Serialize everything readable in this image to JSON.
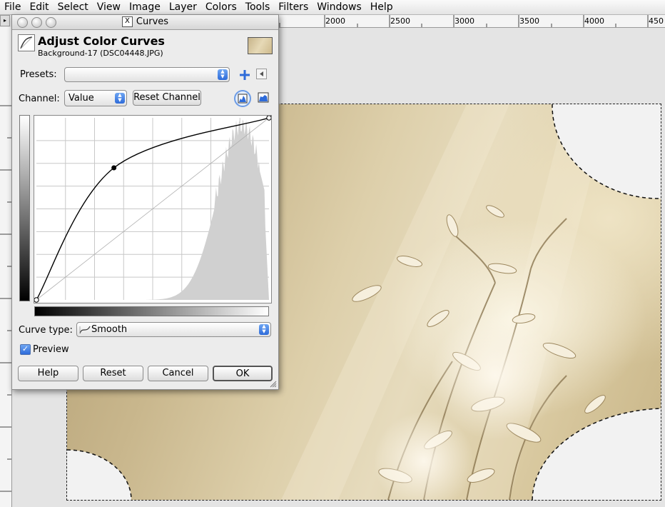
{
  "menubar": {
    "items": [
      {
        "label": "File",
        "key": "F"
      },
      {
        "label": "Edit",
        "key": "E"
      },
      {
        "label": "Select",
        "key": "S"
      },
      {
        "label": "View",
        "key": "V"
      },
      {
        "label": "Image",
        "key": "I"
      },
      {
        "label": "Layer",
        "key": "L"
      },
      {
        "label": "Colors",
        "key": "C"
      },
      {
        "label": "Tools",
        "key": "T"
      },
      {
        "label": "Filters",
        "key": "r"
      },
      {
        "label": "Windows",
        "key": "W"
      },
      {
        "label": "Help",
        "key": "H"
      }
    ]
  },
  "ruler": {
    "ticks": [
      "2000",
      "2500",
      "3000",
      "3500",
      "4000",
      "450"
    ]
  },
  "dialog": {
    "window_title": "Curves",
    "header_title": "Adjust Color Curves",
    "header_subtitle": "Background-17 (DSC04448.JPG)",
    "presets_label": "Presets:",
    "presets_value": "",
    "channel_label": "Channel:",
    "channel_value": "Value",
    "reset_channel_label": "Reset Channel",
    "curve_type_label": "Curve type:",
    "curve_type_value": "Smooth",
    "preview_label": "Preview",
    "preview_checked": true,
    "buttons": {
      "help": "Help",
      "reset": "Reset",
      "cancel": "Cancel",
      "ok": "OK"
    }
  },
  "curve": {
    "points": [
      [
        0,
        0
      ],
      [
        85,
        185
      ],
      [
        255,
        255
      ]
    ],
    "colors": {
      "curve": "#000000",
      "histogram": "#d0d0d0",
      "grid": "#c8c8c8"
    }
  },
  "colors": {
    "accent": "#2e6bd9"
  }
}
